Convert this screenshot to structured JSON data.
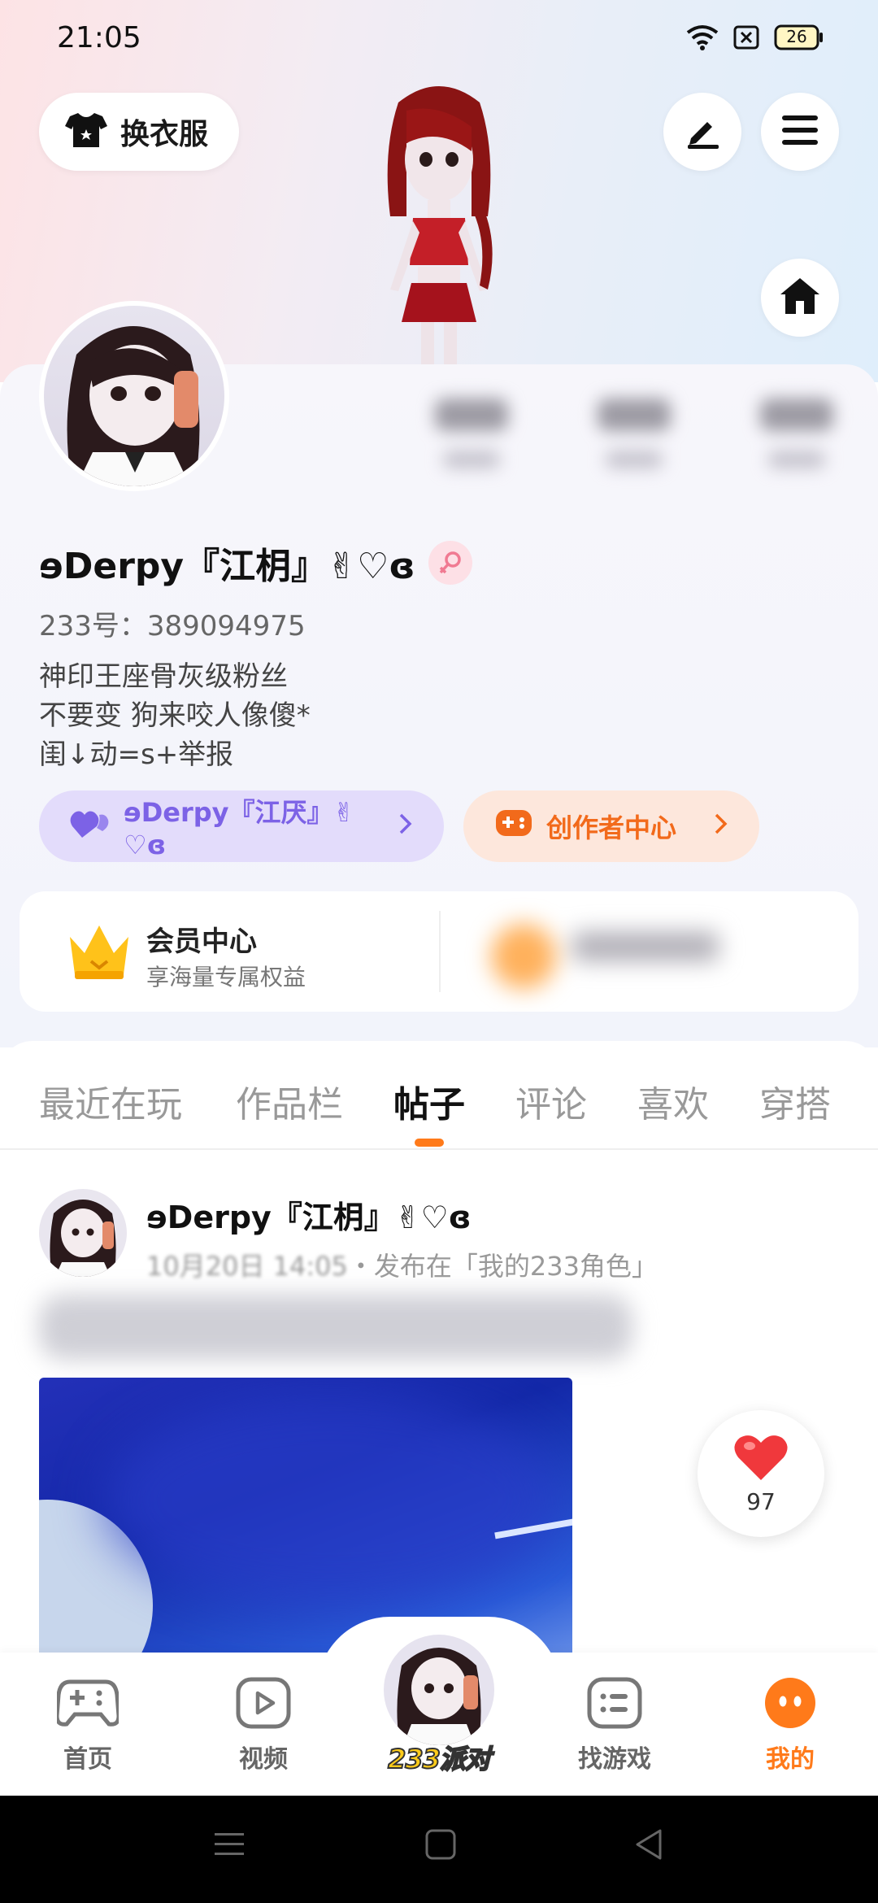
{
  "status_bar": {
    "time": "21:05",
    "battery": "26",
    "icons": [
      "wifi-icon",
      "sim-icon",
      "battery-icon"
    ]
  },
  "header": {
    "outfit_button": "换衣服",
    "edit_icon": "pencil-icon",
    "menu_icon": "menu-icon",
    "home_icon": "house-icon"
  },
  "profile": {
    "username": "ɘDerpy『江枂』✌♡ɞ",
    "user_id": "233号：389094975",
    "bio": [
      "神印王座骨灰级粉丝",
      "不要变 狗来咬人像傻*",
      "闺↓动=s+举报"
    ],
    "fan_pill": "ɘDerpy『江厌』✌♡ɞ",
    "creator_pill": "创作者中心"
  },
  "vip": {
    "title": "会员中心",
    "subtitle": "享海量专属权益"
  },
  "tabs": [
    {
      "label": "最近在玩",
      "active": false
    },
    {
      "label": "作品栏",
      "active": false
    },
    {
      "label": "帖子",
      "active": true
    },
    {
      "label": "评论",
      "active": false
    },
    {
      "label": "喜欢",
      "active": false
    },
    {
      "label": "穿搭",
      "active": false
    }
  ],
  "post": {
    "author": "ɘDerpy『江枂』✌♡ɞ",
    "date_partial": "10月20日 14:05",
    "published_in": "・发布在「我的233角色」",
    "likes": "97"
  },
  "bottom_nav": [
    {
      "label": "首页",
      "icon": "gamepad-icon",
      "active": false
    },
    {
      "label": "视频",
      "icon": "play-icon",
      "active": false
    },
    {
      "label": "233派对",
      "icon": "avatar-icon",
      "active": false
    },
    {
      "label": "找游戏",
      "icon": "list-icon",
      "active": false
    },
    {
      "label": "我的",
      "icon": "face-icon",
      "active": true
    }
  ],
  "colors": {
    "accent": "#ff7a1a",
    "fan_purple": "#7c62e6",
    "creator_orange": "#f26a1b"
  }
}
